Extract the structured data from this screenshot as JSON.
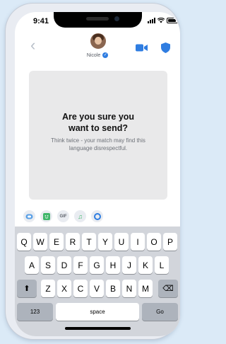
{
  "status_bar": {
    "time": "9:41"
  },
  "header": {
    "contact_name": "Nicole",
    "verified_mark": "✓",
    "back_glyph": "‹",
    "icons": [
      "back-chevron-icon",
      "video-call-icon",
      "shield-icon"
    ]
  },
  "prompt": {
    "title": "Are you sure you want to send?",
    "message": "Think twice - your match may find this language disrespectful."
  },
  "composer": {
    "gif_label": "GIF",
    "music_glyph": "♫",
    "icons": [
      "swipe-icon",
      "sticker-icon",
      "gif-icon",
      "music-icon",
      "circle-icon"
    ]
  },
  "keyboard": {
    "row1": [
      "Q",
      "W",
      "E",
      "R",
      "T",
      "Y",
      "U",
      "I",
      "O",
      "P"
    ],
    "row2": [
      "A",
      "S",
      "D",
      "F",
      "G",
      "H",
      "J",
      "K",
      "L"
    ],
    "row3": [
      "Z",
      "X",
      "C",
      "V",
      "B",
      "N",
      "M"
    ],
    "shift_glyph": "⬆",
    "delete_glyph": "⌫",
    "numbers_label": "123",
    "space_label": "space",
    "go_label": "Go"
  },
  "colors": {
    "accent": "#2f7de1",
    "prompt_bg": "#e9e9ea",
    "keyboard_bg": "#d2d5db"
  }
}
